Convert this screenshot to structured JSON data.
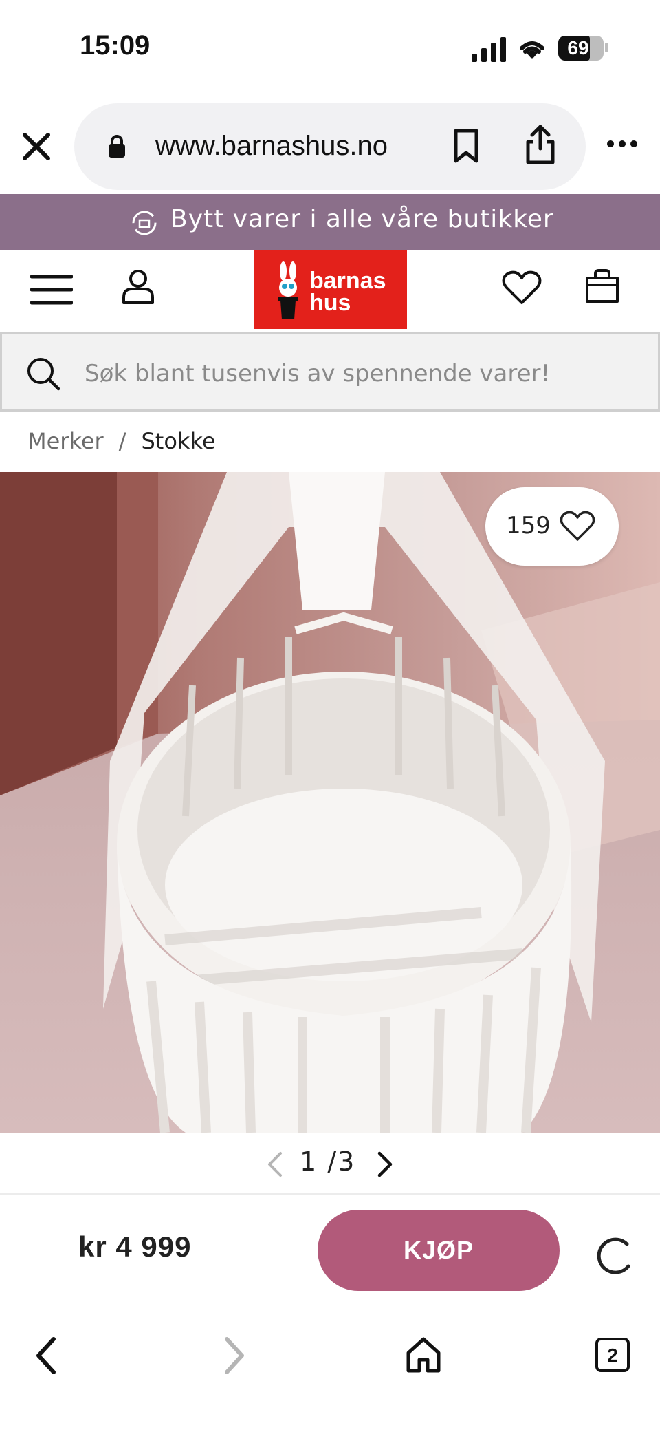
{
  "status": {
    "time": "15:09",
    "battery": "69"
  },
  "browser": {
    "url": "www.barnashus.no"
  },
  "promo": {
    "text": "Bytt varer i alle våre butikker"
  },
  "header": {
    "logo_line1": "barnas",
    "logo_line2": "hus"
  },
  "search": {
    "placeholder": "Søk blant tusenvis av spennende varer!"
  },
  "breadcrumb": {
    "items": [
      "Merker",
      "Stokke"
    ],
    "separator": "/"
  },
  "product": {
    "likes": "159"
  },
  "pager": {
    "current": "1",
    "separator": "/",
    "total": "3"
  },
  "buy": {
    "price": "kr 4 999",
    "button_label": "KJØP"
  },
  "nav": {
    "tab_count": "2"
  },
  "colors": {
    "promo_bg": "#8b6f8a",
    "logo_red": "#e3211b",
    "buy_button": "#b25a7a"
  }
}
